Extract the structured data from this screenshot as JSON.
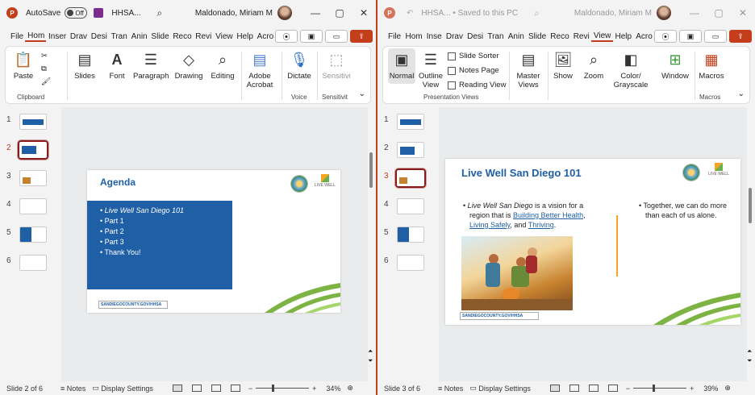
{
  "left": {
    "titlebar": {
      "autosave": "AutoSave",
      "autosave_state": "Off",
      "filename": "HHSA...",
      "user": "Maldonado, Miriam M"
    },
    "tabs": [
      "File",
      "Home",
      "Insert",
      "Draw",
      "Design",
      "Transitions",
      "Animations",
      "Slide Show",
      "Record",
      "Review",
      "View",
      "Help",
      "Acrobat"
    ],
    "tab_display": [
      "File",
      "Hom",
      "Inser",
      "Drav",
      "Desi",
      "Tran",
      "Anin",
      "Slide",
      "Reco",
      "Revi",
      "View",
      "Help",
      "Acro"
    ],
    "active_tab": "Home",
    "ribbon": {
      "paste": "Paste",
      "clipboard": "Clipboard",
      "slides": "Slides",
      "font": "Font",
      "paragraph": "Paragraph",
      "drawing": "Drawing",
      "editing": "Editing",
      "adobe": "Adobe Acrobat",
      "dictate": "Dictate",
      "voice": "Voice",
      "sensitivity": "Sensitivi",
      "sensitivity_group": "Sensitivit"
    },
    "thumbs": [
      "1",
      "2",
      "3",
      "4",
      "5",
      "6"
    ],
    "selected": 2,
    "slide": {
      "title": "Agenda",
      "bullets": [
        "Live Well San Diego 101",
        "Part 1",
        "Part 2",
        "Part 3",
        "Thank You!"
      ],
      "url": "SANDIEGOCOUNTY.GOV/HHSA",
      "logo_text": "LIVE WELL"
    },
    "status": {
      "slide": "Slide 2 of 6",
      "notes": "Notes",
      "display": "Display Settings",
      "zoom": "34%"
    }
  },
  "right": {
    "titlebar": {
      "filename": "HHSA... • Saved to this PC",
      "user": "Maldonado, Miriam M"
    },
    "tabs": [
      "File",
      "Home",
      "Insert",
      "Draw",
      "Design",
      "Transitions",
      "Animations",
      "Slide Show",
      "Record",
      "Review",
      "View",
      "Help",
      "Acrobat"
    ],
    "tab_display": [
      "File",
      "Hom",
      "Inse",
      "Drav",
      "Desi",
      "Tran",
      "Anin",
      "Slide",
      "Reco",
      "Revi",
      "View",
      "Help",
      "Acro"
    ],
    "active_tab": "View",
    "ribbon": {
      "normal": "Normal",
      "outline": "Outline View",
      "sorter": "Slide Sorter",
      "notes_page": "Notes Page",
      "reading": "Reading View",
      "pres_views": "Presentation Views",
      "master": "Master Views",
      "show": "Show",
      "zoom": "Zoom",
      "color": "Color/ Grayscale",
      "window": "Window",
      "macros": "Macros",
      "macros_group": "Macros"
    },
    "thumbs": [
      "1",
      "2",
      "3",
      "4",
      "5",
      "6"
    ],
    "selected": 3,
    "slide": {
      "title": "Live Well San Diego 101",
      "left_text_italic": "Live Well San Diego",
      "left_text_1": " is a vision for a region that is ",
      "link1": "Building Better Health",
      "sep1": ", ",
      "link2": "Living Safely",
      "sep2": ", and ",
      "link3": "Thriving",
      "end": ".",
      "right_text": "Together, we can do more than each of us alone.",
      "url": "SANDIEGOCOUNTY.GOV/HHSA",
      "logo_text": "LIVE WELL"
    },
    "status": {
      "slide": "Slide 3 of 6",
      "notes": "Notes",
      "display": "Display Settings",
      "zoom": "39%"
    }
  },
  "colors": {
    "accent": "#c43e1c",
    "slide_blue": "#1f5fa6",
    "green": "#7cb342",
    "orange": "#f4a623"
  }
}
